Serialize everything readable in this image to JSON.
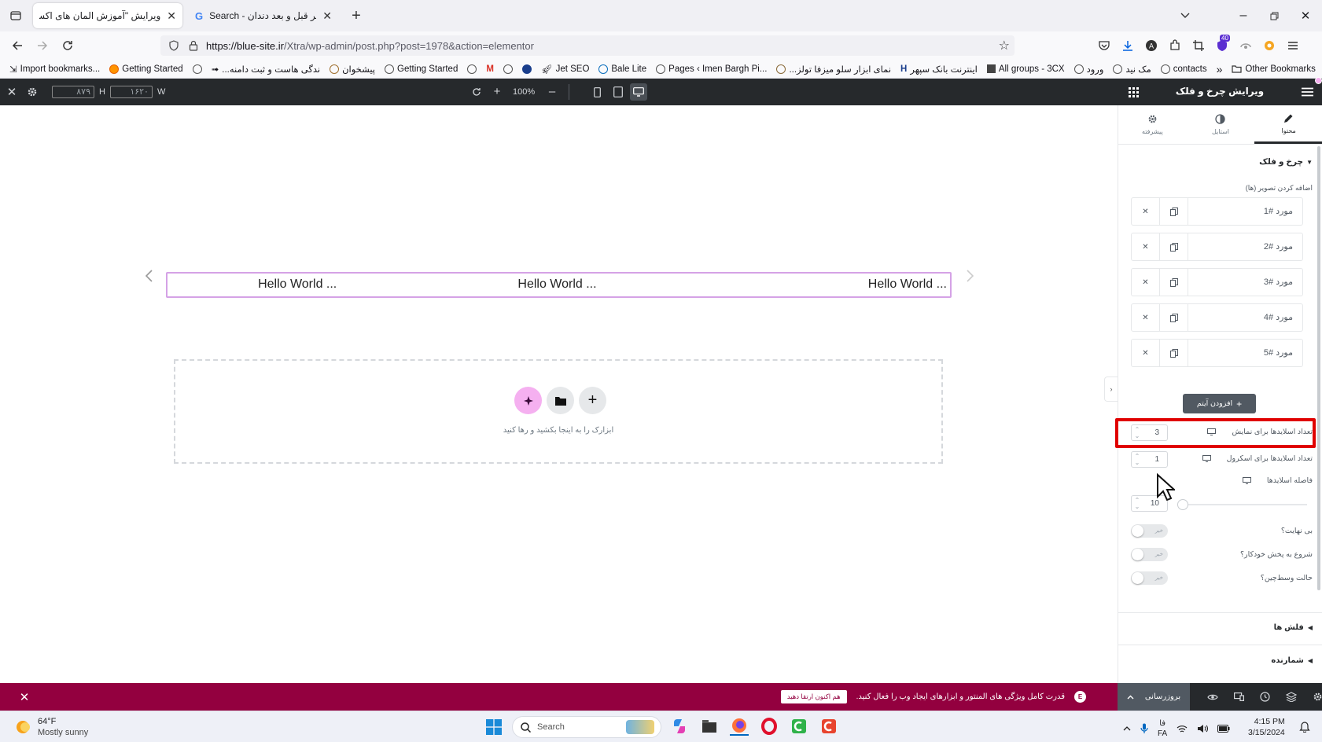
{
  "browser": {
    "tabs": [
      {
        "title": "ویرایش \"آموزش المان های اکسترا – ...",
        "active": true
      },
      {
        "title": "Search - تصویر قبل و بعد دندان",
        "active": false
      }
    ],
    "url_host": "https://blue-site.ir",
    "url_path": "/Xtra/wp-admin/post.php?post=1978&action=elementor",
    "bookmarks": [
      "Import bookmarks...",
      "Getting Started",
      "...ندگی هاست و ثبت دامنه",
      "پیشخوان",
      "Getting Started",
      "Jet SEO",
      "Bale Lite",
      "Pages ‹ Imen Bargh Pi...",
      "...نمای ابزار سلو میزفا تولز",
      "اینترنت بانک سپهر",
      "All groups - 3CX",
      "ورود",
      "مک نید",
      "contacts"
    ],
    "other_bookmarks": "Other Bookmarks",
    "addon_badge": "40"
  },
  "editor_top": {
    "height_label": "H",
    "height_value": "۸۷۹",
    "width_label": "W",
    "width_value": "۱۶۲۰",
    "zoom": "100%"
  },
  "canvas": {
    "slides": [
      "Hello World ...",
      "Hello World ...",
      "Hello World ..."
    ],
    "drop_text": "ابزارک را به اینجا بکشید و رها کنید"
  },
  "panel": {
    "title": "ویرایش چرخ و فلک",
    "tabs": [
      {
        "label": "محتوا",
        "icon": "pencil-icon",
        "active": true
      },
      {
        "label": "استایل",
        "icon": "contrast-icon",
        "active": false
      },
      {
        "label": "پیشرفته",
        "icon": "gear-icon",
        "active": false
      }
    ],
    "section_title": "چرخ و فلک",
    "add_images_label": "اضافه کردن تصویر (ها)",
    "items": [
      "مورد #1",
      "مورد #2",
      "مورد #3",
      "مورد #4",
      "مورد #5"
    ],
    "add_item_label": "افزودن آیتم",
    "slides_to_show_label": "تعداد اسلایدها برای نمایش",
    "slides_to_show_value": "3",
    "slides_to_scroll_label": "تعداد اسلایدها برای اسکرول",
    "slides_to_scroll_value": "1",
    "slide_gap_label": "فاصله اسلایدها",
    "slide_gap_value": "10",
    "slide_gap_fraction": 0.0,
    "infinite_label": "بی نهایت؟",
    "autoplay_label": "شروع به پخش خودکار؟",
    "center_mode_label": "حالت وسط‌چین؟",
    "toggle_off_text": "خیر",
    "arrows_section": "فلش ها",
    "counter_section": "شمارنده",
    "highlight_color": "#e00000"
  },
  "notice": {
    "message": "قدرت کامل ویژگی های المنتور و ابزارهای ایجاد وب را فعال کنید.",
    "cta": "هم اکنون ارتقا دهید"
  },
  "panel_footer": {
    "update_label": "بروزرسانی"
  },
  "taskbar": {
    "weather_temp": "64°F",
    "weather_desc": "Mostly sunny",
    "search_placeholder": "Search",
    "lang_top": "فا",
    "lang_bottom": "FA",
    "time": "4:15 PM",
    "date": "3/15/2024"
  },
  "colors": {
    "editor_dark": "#26292c",
    "notice_bg": "#93003f",
    "ai_pink": "#f5b0f0",
    "slider_border": "#d5a2e6"
  }
}
